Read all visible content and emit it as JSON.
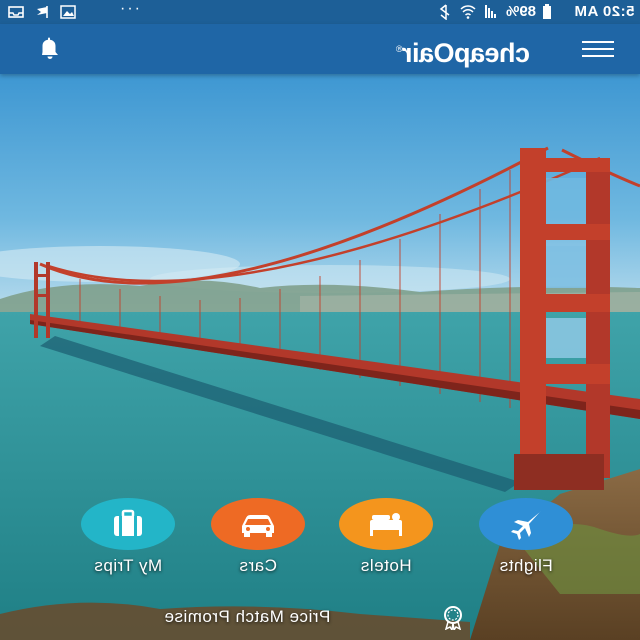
{
  "status_bar": {
    "time": "5:20 AM",
    "battery": "89%",
    "overflow_dots": "···",
    "icons": [
      "battery-icon",
      "signal-icon",
      "wifi-icon",
      "bluetooth-icon",
      "image-icon",
      "flag-icon",
      "inbox-icon"
    ]
  },
  "app_bar": {
    "logo_text": "cheapOair",
    "logo_registered": "®",
    "bell_icon": "bell-icon",
    "menu_icon": "hamburger-menu-icon"
  },
  "hero": {
    "scene": "golden-gate-bridge"
  },
  "nav": {
    "flights": {
      "label": "Flights",
      "icon": "airplane-icon",
      "color": "#2f8fd6"
    },
    "hotels": {
      "label": "Hotels",
      "icon": "bed-icon",
      "color": "#f4951d"
    },
    "cars": {
      "label": "Cars",
      "icon": "car-icon",
      "color": "#ee6a24"
    },
    "my_trips": {
      "label": "My Trips",
      "icon": "suitcase-icon",
      "color": "#23b5c8"
    }
  },
  "footer": {
    "price_match_label": "Price Match Promise",
    "icon": "price-badge-icon"
  },
  "colors": {
    "status_bar": "#1d5f97",
    "app_bar": "#1f66a6",
    "sky": "#4fa3d6",
    "water": "#2e8f95",
    "bridge": "#c3402b"
  }
}
